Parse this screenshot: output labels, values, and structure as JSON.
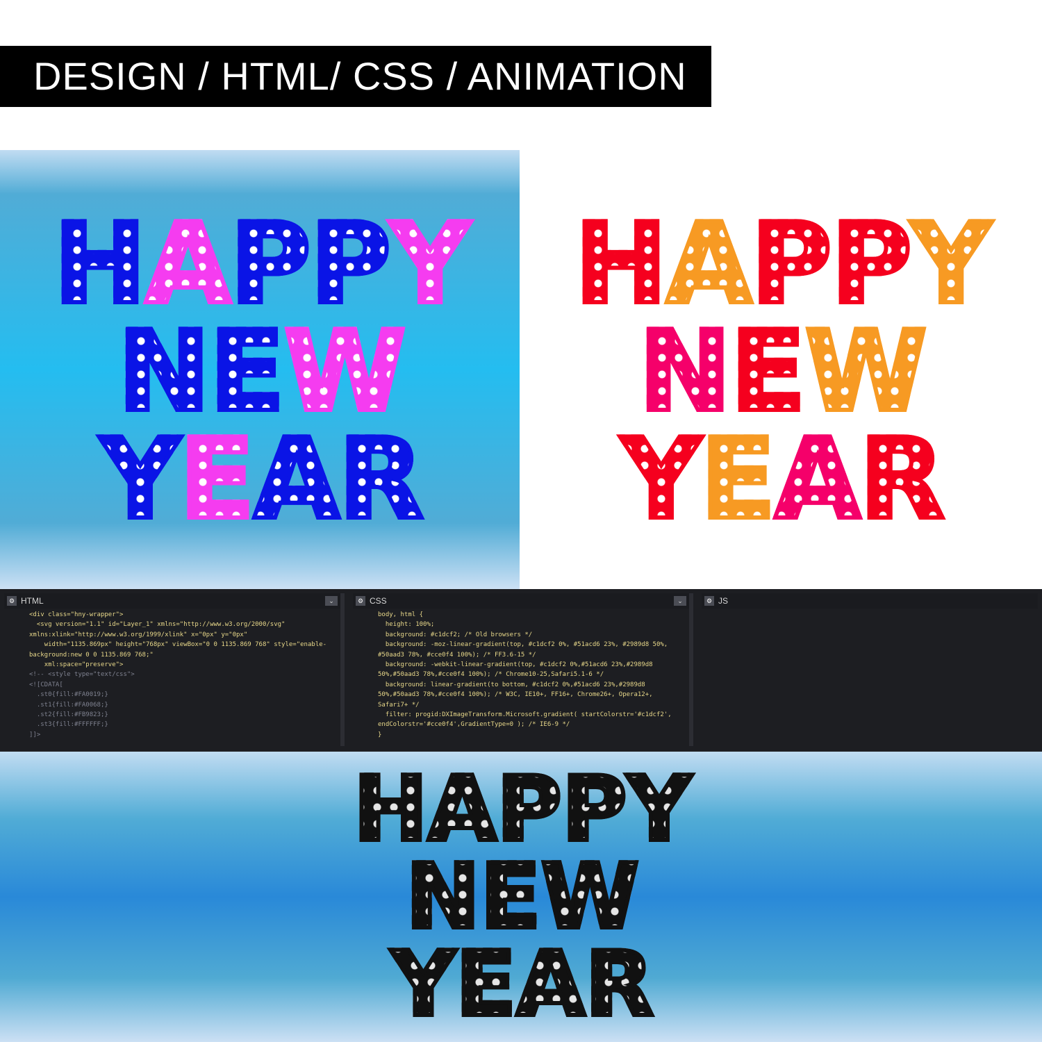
{
  "banner": {
    "title": "DESIGN / HTML/ CSS / ANIMATION"
  },
  "colors": {
    "blue": "#0a14e6",
    "magenta": "#f53cf0",
    "red": "#f5001e",
    "orange": "#f79a23",
    "pink": "#f5006a",
    "black": "#111111"
  },
  "left": {
    "rows": [
      [
        [
          "H",
          "blue"
        ],
        [
          "A",
          "magenta"
        ],
        [
          "P",
          "blue"
        ],
        [
          "P",
          "blue"
        ],
        [
          "Y",
          "magenta"
        ]
      ],
      [
        [
          "N",
          "blue"
        ],
        [
          "E",
          "blue"
        ],
        [
          "W",
          "magenta"
        ]
      ],
      [
        [
          "Y",
          "blue"
        ],
        [
          "E",
          "magenta"
        ],
        [
          "A",
          "blue"
        ],
        [
          "R",
          "blue"
        ]
      ]
    ]
  },
  "right": {
    "rows": [
      [
        [
          "H",
          "red"
        ],
        [
          "A",
          "orange"
        ],
        [
          "P",
          "red"
        ],
        [
          "P",
          "red"
        ],
        [
          "Y",
          "orange"
        ]
      ],
      [
        [
          "N",
          "pink"
        ],
        [
          "E",
          "red"
        ],
        [
          "W",
          "orange"
        ]
      ],
      [
        [
          "Y",
          "red"
        ],
        [
          "E",
          "orange"
        ],
        [
          "A",
          "pink"
        ],
        [
          "R",
          "red"
        ]
      ]
    ]
  },
  "bottom": {
    "rows": [
      [
        [
          "H",
          "black"
        ],
        [
          "A",
          "black"
        ],
        [
          "P",
          "black"
        ],
        [
          "P",
          "black"
        ],
        [
          "Y",
          "black"
        ]
      ],
      [
        [
          "N",
          "black"
        ],
        [
          "E",
          "black"
        ],
        [
          "W",
          "black"
        ]
      ],
      [
        [
          "Y",
          "black"
        ],
        [
          "E",
          "black"
        ],
        [
          "A",
          "black"
        ],
        [
          "R",
          "black"
        ]
      ]
    ]
  },
  "editor": {
    "html": {
      "label": "HTML",
      "lines": [
        "<div class=\"hny-wrapper\">",
        "  <svg version=\"1.1\" id=\"Layer_1\" xmlns=\"http://www.w3.org/2000/svg\" xmlns:xlink=\"http://www.w3.org/1999/xlink\" x=\"0px\" y=\"0px\"",
        "    width=\"1135.869px\" height=\"768px\" viewBox=\"0 0 1135.869 768\" style=\"enable-background:new 0 0 1135.869 768;\"",
        "    xml:space=\"preserve\">",
        "<!-- <style type=\"text/css\">",
        "<![CDATA[",
        "  .st0{fill:#FA0019;}",
        "  .st1{fill:#FA0068;}",
        "  .st2{fill:#FB9823;}",
        "  .st3{fill:#FFFFFF;}",
        "]]>"
      ]
    },
    "css": {
      "label": "CSS",
      "lines": [
        "body, html {",
        "  height: 100%;",
        "  background: #c1dcf2; /* Old browsers */",
        "  background: -moz-linear-gradient(top, #c1dcf2 0%, #51acd6 23%, #2989d8 50%, #50aad3 78%, #cce0f4 100%); /* FF3.6-15 */",
        "  background: -webkit-linear-gradient(top, #c1dcf2 0%,#51acd6 23%,#2989d8 50%,#50aad3 78%,#cce0f4 100%); /* Chrome10-25,Safari5.1-6 */",
        "  background: linear-gradient(to bottom, #c1dcf2 0%,#51acd6 23%,#2989d8 50%,#50aad3 78%,#cce0f4 100%); /* W3C, IE10+, FF16+, Chrome26+, Opera12+, Safari7+ */",
        "  filter: progid:DXImageTransform.Microsoft.gradient( startColorstr='#c1dcf2', endColorstr='#cce0f4',GradientType=0 ); /* IE6-9 */",
        "}"
      ]
    },
    "js": {
      "label": "JS",
      "lines": []
    }
  }
}
